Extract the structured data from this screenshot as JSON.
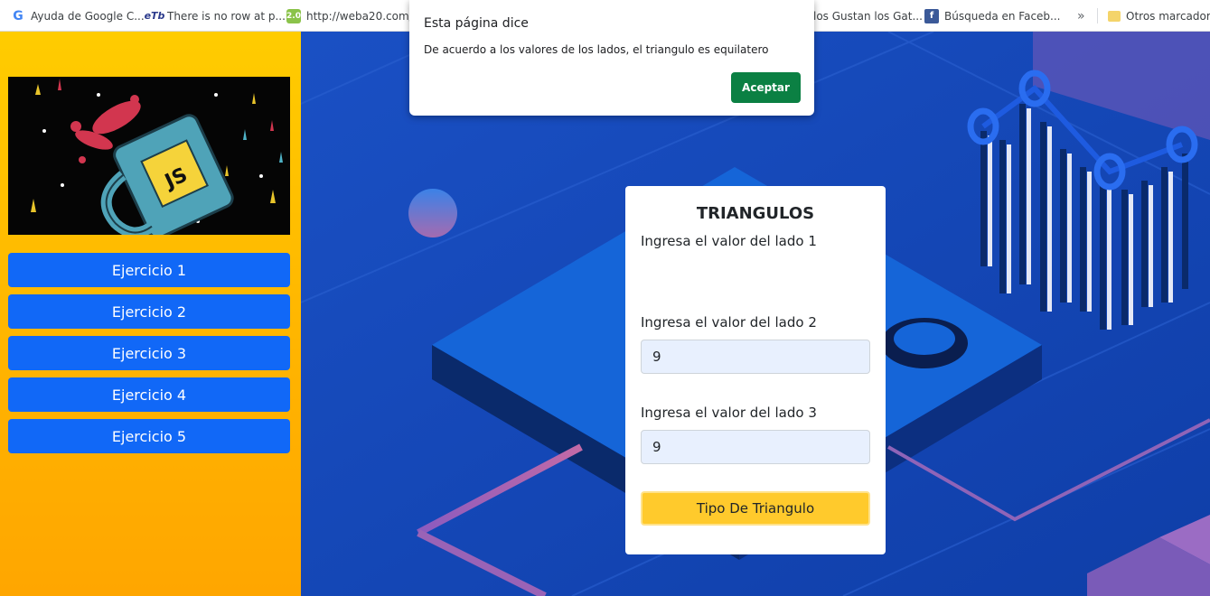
{
  "bookmarks": {
    "items": [
      {
        "label": "Ayuda de Google C...",
        "icon": "google-icon"
      },
      {
        "label": "There is no row at p...",
        "icon": "etb-icon"
      },
      {
        "label": "http://weba20.com/...",
        "icon": "web20-icon"
      },
      {
        "label": "los Gustan los Gat...",
        "icon": "page-icon"
      },
      {
        "label": "Búsqueda en Faceb...",
        "icon": "facebook-icon"
      }
    ],
    "overflow": "»",
    "other_folder": "Otros marcadores",
    "icon_labels": {
      "google": "G",
      "etb": "eTb",
      "web20": "2.0",
      "facebook": "f"
    }
  },
  "sidebar": {
    "banner_icon": "javascript-mug-illustration",
    "banner_text": "JS",
    "buttons": [
      "Ejercicio 1",
      "Ejercicio 2",
      "Ejercicio 3",
      "Ejercicio 4",
      "Ejercicio 5"
    ]
  },
  "form": {
    "title": "TRIANGULOS",
    "side1_label": "Ingresa el valor del lado 1",
    "side1_value": "",
    "side2_label": "Ingresa el valor del lado 2",
    "side2_value": "9",
    "side3_label": "Ingresa el valor del lado 3",
    "side3_value": "9",
    "submit_label": "Tipo De Triangulo"
  },
  "dialog": {
    "title": "Esta página dice",
    "message": "De acuerdo a los valores de los lados, el triangulo es equilatero",
    "ok_label": "Aceptar"
  },
  "colors": {
    "sidebar_top": "#ffcc00",
    "nav_button": "#1168f7",
    "background": "#1446b8",
    "submit": "#ffca2c",
    "dialog_ok": "#0b8043"
  }
}
